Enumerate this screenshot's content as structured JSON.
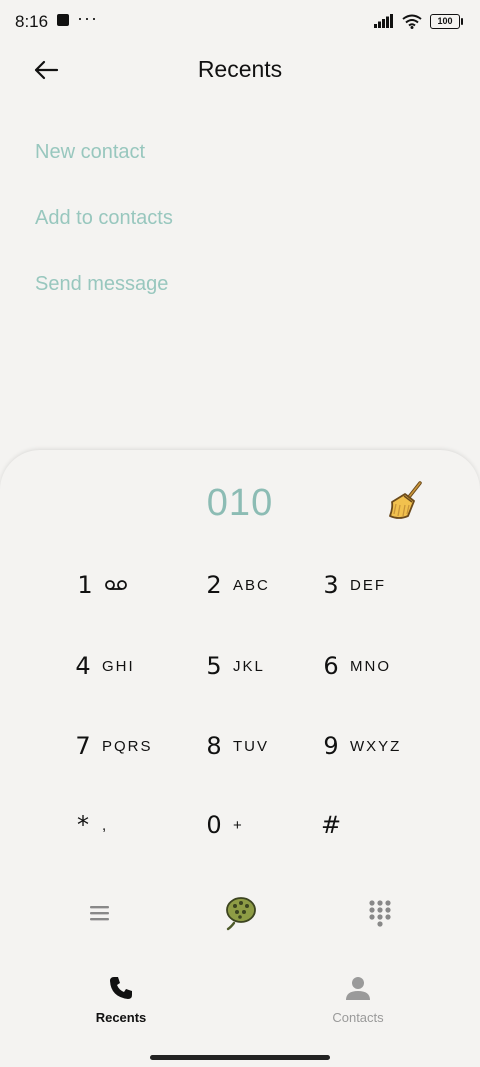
{
  "status": {
    "time": "8:16",
    "dots": "···",
    "battery": "100"
  },
  "header": {
    "title": "Recents"
  },
  "actions": [
    {
      "label": "New contact"
    },
    {
      "label": "Add to contacts"
    },
    {
      "label": "Send message"
    }
  ],
  "dialer": {
    "number": "010",
    "keys": [
      {
        "digit": "1",
        "letters": ""
      },
      {
        "digit": "2",
        "letters": "ABC"
      },
      {
        "digit": "3",
        "letters": "DEF"
      },
      {
        "digit": "4",
        "letters": "GHI"
      },
      {
        "digit": "5",
        "letters": "JKL"
      },
      {
        "digit": "6",
        "letters": "MNO"
      },
      {
        "digit": "7",
        "letters": "PQRS"
      },
      {
        "digit": "8",
        "letters": "TUV"
      },
      {
        "digit": "9",
        "letters": "WXYZ"
      },
      {
        "digit": "*",
        "letters": ","
      },
      {
        "digit": "0",
        "letters": "+"
      },
      {
        "digit": "#",
        "letters": ""
      }
    ]
  },
  "tabs": [
    {
      "label": "Recents",
      "active": true
    },
    {
      "label": "Contacts",
      "active": false
    }
  ],
  "colors": {
    "accent": "#98c7be",
    "number": "#8cbcb4",
    "inactive": "#9a9a9a"
  }
}
